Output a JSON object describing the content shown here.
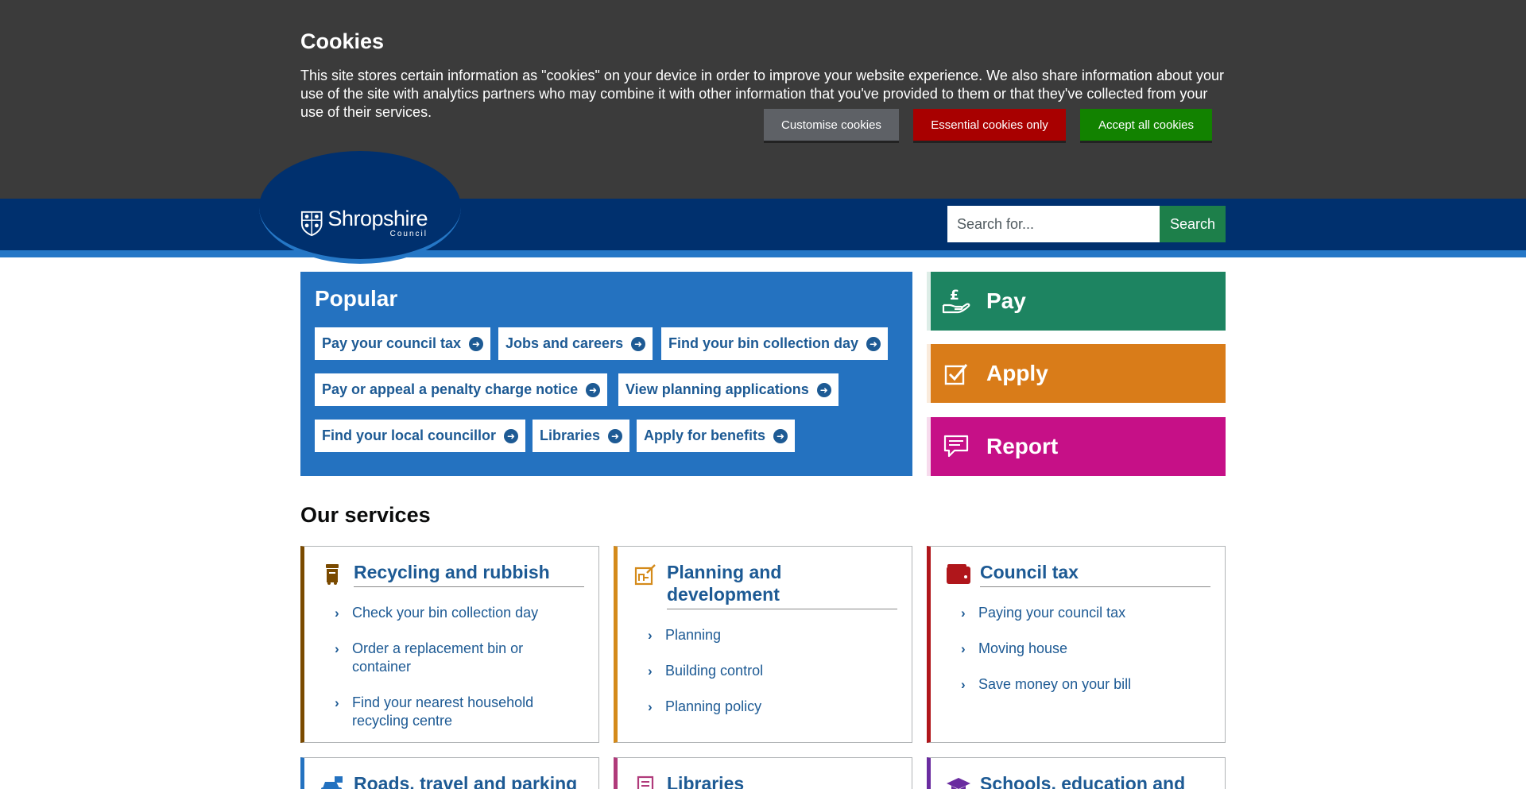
{
  "cookie_banner": {
    "title": "Cookies",
    "text": "This site stores certain information as \"cookies\" on your device in order to improve your website experience. We also share information about your use of the site with analytics partners who may combine it with other information that you've provided to them or that they've collected from your use of their services.",
    "buttons": {
      "customise": "Customise cookies",
      "essential": "Essential cookies only",
      "accept": "Accept all cookies"
    }
  },
  "header": {
    "logo_name": "Shropshire",
    "logo_sub": "Council",
    "search_placeholder": "Search for...",
    "search_button": "Search"
  },
  "popular": {
    "title": "Popular",
    "links": [
      "Pay your council tax",
      "Jobs and careers",
      "Find your bin collection day",
      "Pay or appeal a penalty charge notice",
      "View planning applications",
      "Find your local councillor",
      "Libraries",
      "Apply for benefits"
    ]
  },
  "actions": {
    "pay": "Pay",
    "apply": "Apply",
    "report": "Report"
  },
  "services": {
    "title": "Our services",
    "cards": [
      {
        "title": "Recycling and rubbish",
        "items": [
          "Check your bin collection day",
          "Order a replacement bin or container",
          "Find your nearest household recycling centre"
        ]
      },
      {
        "title": "Planning and development",
        "items": [
          "Planning",
          "Building control",
          "Planning policy"
        ]
      },
      {
        "title": "Council tax",
        "items": [
          "Paying your council tax",
          "Moving house",
          "Save money on your bill"
        ]
      },
      {
        "title": "Roads, travel and parking",
        "items": []
      },
      {
        "title": "Libraries",
        "items": []
      },
      {
        "title": "Schools, education and",
        "items": []
      }
    ]
  },
  "colors": {
    "header": "#00306e",
    "popular": "#2472c0",
    "pay": "#1d8461",
    "apply": "#d97c19",
    "report": "#c61087",
    "recycling": "#7a4a00",
    "planning": "#d48a1a",
    "council_tax": "#b0161b",
    "roads": "#2472c0",
    "libraries": "#b03a7a",
    "schools": "#6a2ca0"
  }
}
